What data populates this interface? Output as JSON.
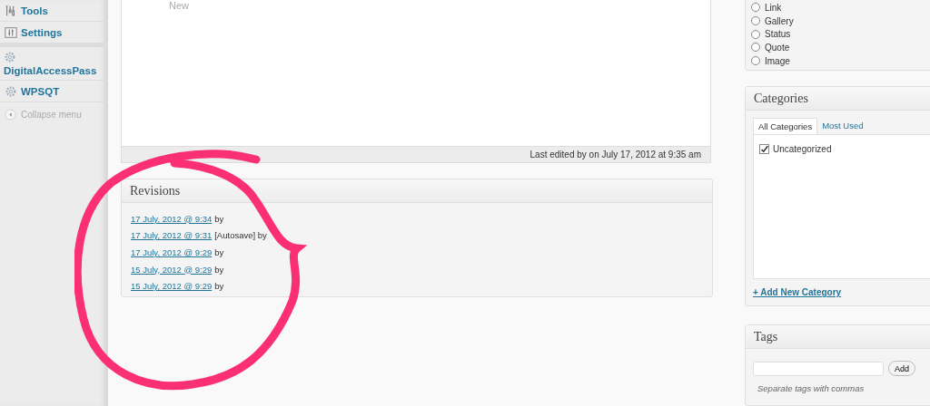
{
  "sidebar": {
    "items": [
      {
        "kind": "tools",
        "label": "Tools"
      },
      {
        "kind": "settings",
        "label": "Settings"
      },
      {
        "kind": "plugin-stacked",
        "label": "DigitalAccessPass"
      },
      {
        "kind": "plugin",
        "label": "WPSQT"
      }
    ],
    "collapse": "Collapse menu"
  },
  "editor": {
    "text": "New",
    "last_edited": "Last edited by on July 17, 2012 at 9:35 am"
  },
  "revisions": {
    "title": "Revisions",
    "items": [
      {
        "link": "17 July, 2012 @ 9:34",
        "note": "by"
      },
      {
        "link": "17 July, 2012 @ 9:31",
        "note": "[Autosave] by"
      },
      {
        "link": "17 July, 2012 @ 9:29",
        "note": "by"
      },
      {
        "link": "15 July, 2012 @ 9:29",
        "note": "by"
      },
      {
        "link": "15 July, 2012 @ 9:29",
        "note": "by"
      }
    ]
  },
  "format": {
    "options": [
      {
        "label": "Link",
        "selected": false
      },
      {
        "label": "Gallery",
        "selected": false
      },
      {
        "label": "Status",
        "selected": false
      },
      {
        "label": "Quote",
        "selected": false
      },
      {
        "label": "Image",
        "selected": false
      }
    ]
  },
  "categories": {
    "title": "Categories",
    "tabs": [
      {
        "label": "All Categories",
        "selected": true
      },
      {
        "label": "Most Used",
        "selected": false
      }
    ],
    "items": [
      {
        "label": "Uncategorized",
        "checked": true
      }
    ],
    "add_link": "+ Add New Category"
  },
  "tags": {
    "title": "Tags",
    "button": "Add",
    "hint": "Separate tags with commas"
  }
}
